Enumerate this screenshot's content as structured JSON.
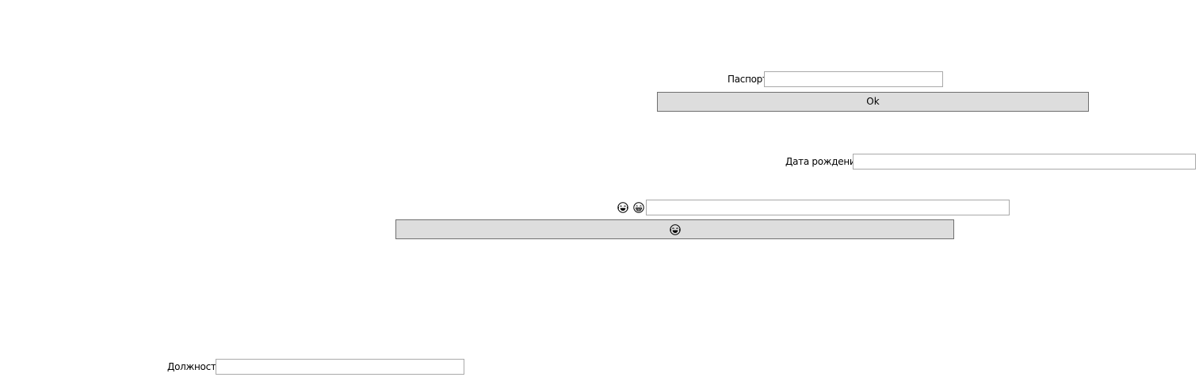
{
  "form": {
    "passport": {
      "label": "Паспорт",
      "value": ""
    },
    "ok_button": {
      "label": "Ok"
    },
    "birth_date": {
      "label": "Дата рождения",
      "value": ""
    },
    "emoji_field": {
      "icons": [
        "laughing-crying-face-icon",
        "grinning-face-icon"
      ],
      "value": ""
    },
    "emoji_button": {
      "icon": "laughing-crying-face-icon"
    },
    "position": {
      "label": "Должность",
      "value": ""
    }
  },
  "colors": {
    "background": "#ffffff",
    "button_fill": "#dddddd",
    "button_border": "#6f6f6f",
    "field_border": "#a9a9a9"
  }
}
